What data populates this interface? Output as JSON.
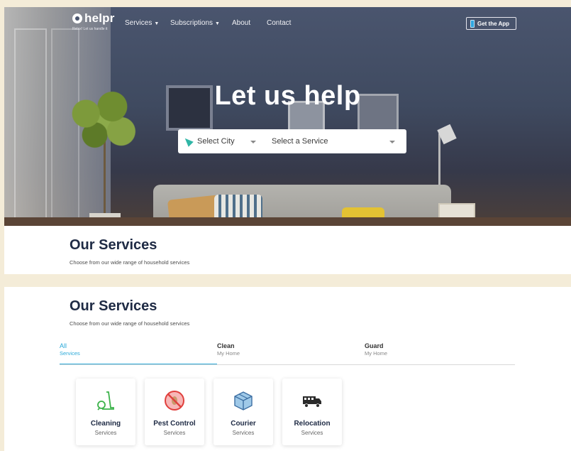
{
  "nav": {
    "logo": "helpr",
    "tagline": "Relax! Let us handle it",
    "links": [
      {
        "label": "Services",
        "has_dropdown": true
      },
      {
        "label": "Subscriptions",
        "has_dropdown": true
      },
      {
        "label": "About",
        "has_dropdown": false
      },
      {
        "label": "Contact",
        "has_dropdown": false
      }
    ],
    "get_app": "Get the App"
  },
  "hero": {
    "title": "Let us help",
    "city_placeholder": "Select City",
    "service_placeholder": "Select a Service"
  },
  "services_section": {
    "title": "Our Services",
    "subtitle": "Choose from our wide range of household services"
  },
  "tabs": [
    {
      "title": "All",
      "sub": "Services",
      "active": true
    },
    {
      "title": "Clean",
      "sub": "My Home",
      "active": false
    },
    {
      "title": "Guard",
      "sub": "My Home",
      "active": false
    }
  ],
  "cards": [
    {
      "title": "Cleaning",
      "sub": "Services",
      "icon": "vacuum-icon"
    },
    {
      "title": "Pest Control",
      "sub": "Services",
      "icon": "no-pest-icon"
    },
    {
      "title": "Courier",
      "sub": "Services",
      "icon": "package-icon"
    },
    {
      "title": "Relocation",
      "sub": "Services",
      "icon": "truck-icon"
    }
  ],
  "colors": {
    "accent": "#2aa9d8",
    "heading": "#1e2a44",
    "nav_icon": "#30b6a6"
  }
}
